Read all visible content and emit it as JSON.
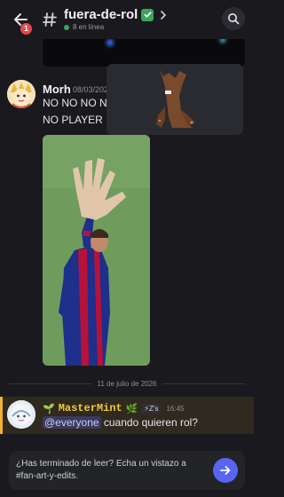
{
  "header": {
    "channel_name": "fuera-de-rol",
    "unread_count": "1",
    "online_text": "8 en línea"
  },
  "messages": [
    {
      "author": "Morh",
      "time": "08/03/202",
      "lines": [
        "NO NO NO NO",
        "NO PLAYER N"
      ]
    }
  ],
  "date_divider": "11 de julio de 2026",
  "mention_message": {
    "author": "MasterMint",
    "author_prefix_emoji": "🌱",
    "author_suffix_emoji": "🌿",
    "tag": "⚡Z's",
    "time": "16:45",
    "mention": "@everyone",
    "text": " cuando quieren rol?"
  },
  "composer": {
    "placeholder": "¿Has terminado de leer? Echa un vistazo a #fan-art-y-edits."
  },
  "colors": {
    "background": "#1a1a1e",
    "accent": "#5865f2",
    "online": "#3ba55c",
    "badge": "#e5484d",
    "mention_highlight": "#f0b232"
  },
  "icons": [
    "back-arrow-icon",
    "hash-icon",
    "check-icon",
    "chevron-right-icon",
    "search-icon",
    "send-arrow-icon"
  ]
}
